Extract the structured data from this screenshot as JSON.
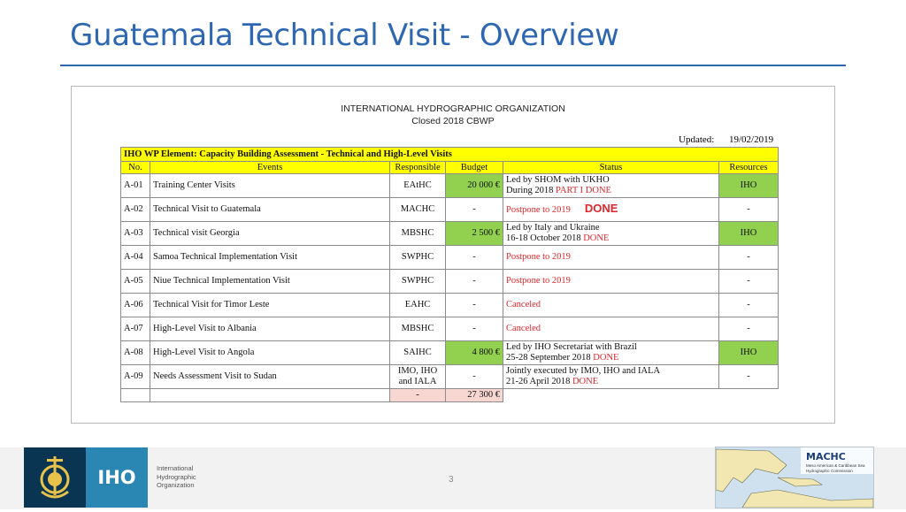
{
  "slide": {
    "title": "Guatemala Technical Visit - Overview",
    "page_number": "3"
  },
  "document": {
    "org_name": "INTERNATIONAL HYDROGRAPHIC ORGANIZATION",
    "subtitle": "Closed 2018 CBWP",
    "updated_label": "Updated:",
    "updated_date": "19/02/2019",
    "table_title": "IHO WP Element: Capacity Building Assessment - Technical and High-Level Visits",
    "columns": [
      "No.",
      "Events",
      "Responsible",
      "Budget",
      "Status",
      "Resources"
    ],
    "rows": [
      {
        "no": "A-01",
        "event": "Training Center Visits",
        "responsible": "EAtHC",
        "budget": "20 000 €",
        "status_1": "Led by SHOM with UKHO",
        "status_2": "During 2018 ",
        "status_2_red": "PART I DONE",
        "resources": "IHO"
      },
      {
        "no": "A-02",
        "event": "Technical Visit to Guatemala",
        "responsible": "MACHC",
        "budget": "-",
        "status_red": "Postpone to 2019",
        "done": "DONE",
        "resources": "-"
      },
      {
        "no": "A-03",
        "event": "Technical visit Georgia",
        "responsible": "MBSHC",
        "budget": "2 500 €",
        "status_1": "Led by Italy and Ukraine",
        "status_2": "16-18 October 2018 ",
        "status_2_red": "DONE",
        "resources": "IHO"
      },
      {
        "no": "A-04",
        "event": "Samoa Technical Implementation Visit",
        "responsible": "SWPHC",
        "budget": "-",
        "status_red": "Postpone to 2019",
        "resources": "-"
      },
      {
        "no": "A-05",
        "event": "Niue Technical Implementation Visit",
        "responsible": "SWPHC",
        "budget": "-",
        "status_red": "Postpone to 2019",
        "resources": "-"
      },
      {
        "no": "A-06",
        "event": "Technical Visit for Timor Leste",
        "responsible": "EAHC",
        "budget": "-",
        "status_red": "Canceled",
        "resources": "-"
      },
      {
        "no": "A-07",
        "event": "High-Level Visit to Albania",
        "responsible": "MBSHC",
        "budget": "-",
        "status_red": "Canceled",
        "resources": "-"
      },
      {
        "no": "A-08",
        "event": "High-Level Visit to Angola",
        "responsible": "SAIHC",
        "budget": "4 800 €",
        "status_1": "Led by IHO Secretariat with Brazil",
        "status_2": "25-28 September 2018 ",
        "status_2_red": "DONE",
        "resources": "IHO"
      },
      {
        "no": "A-09",
        "event": "Needs Assessment Visit to Sudan",
        "responsible_1": "IMO, IHO",
        "responsible_2": "and IALA",
        "budget": "-",
        "status_1": "Jointly executed by IMO, IHO and IALA",
        "status_2": "21-26 April 2018 ",
        "status_2_red": "DONE",
        "resources": "-"
      }
    ],
    "total_responsible": "-",
    "total_budget": "27 300 €"
  },
  "footer": {
    "iho_label": "IHO",
    "iho_line1": "International",
    "iho_line2": "Hydrographic",
    "iho_line3": "Organization",
    "machc_label": "MACHC",
    "machc_sub": "Meso American & Caribbean Sea Hydrographic Commission"
  },
  "colors": {
    "title_blue": "#2e67b1",
    "header_yellow": "#ffff00",
    "budget_green": "#92d050",
    "done_red": "#e0262b"
  }
}
